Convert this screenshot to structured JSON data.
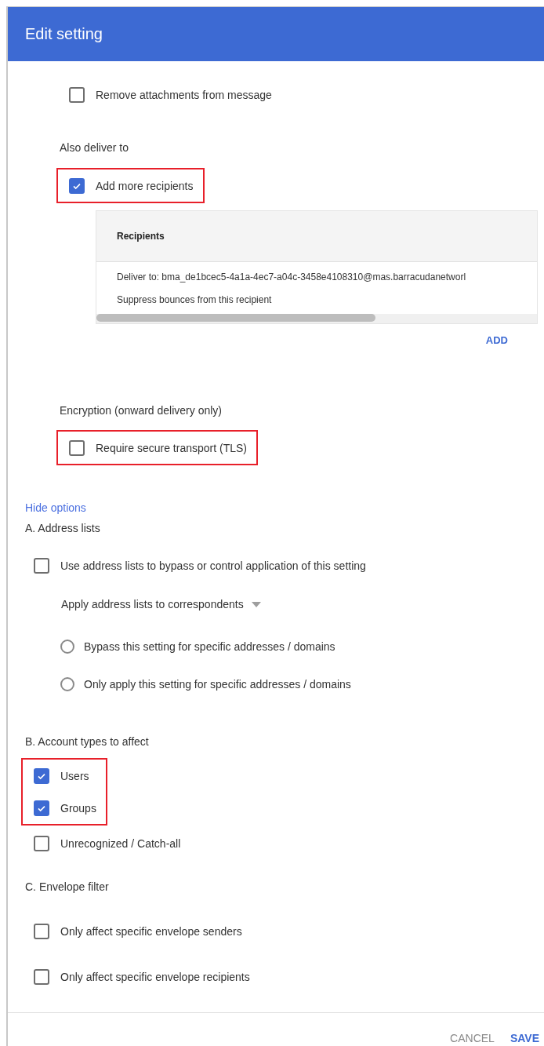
{
  "dialog": {
    "title": "Edit setting"
  },
  "attachments_option": {
    "label": "Remove attachments from message",
    "checked": false,
    "highlighted": false
  },
  "also_deliver": {
    "heading": "Also deliver to",
    "option": {
      "label": "Add more recipients",
      "checked": true,
      "highlighted": true
    },
    "recipients_table": {
      "column": "Recipients",
      "rows": [
        {
          "lines": [
            "Deliver to: bma_de1bcec5-4a1a-4ec7-a04c-3458e4108310@mas.barracudanetworl",
            "Suppress bounces from this recipient"
          ]
        }
      ]
    },
    "add_button": "ADD"
  },
  "encryption": {
    "heading": "Encryption (onward delivery only)",
    "option": {
      "label": "Require secure transport (TLS)",
      "checked": false,
      "highlighted": true
    }
  },
  "hide_options_link": "Hide options",
  "address_lists": {
    "heading": "A. Address lists",
    "option": {
      "label": "Use address lists to bypass or control application of this setting",
      "checked": false,
      "highlighted": false
    },
    "dropdown": {
      "label": "Apply address lists to correspondents"
    },
    "radios": [
      {
        "label": "Bypass this setting for specific addresses / domains",
        "selected": false
      },
      {
        "label": "Only apply this setting for specific addresses / domains",
        "selected": false
      }
    ]
  },
  "account_types": {
    "heading": "B. Account types to affect",
    "options": [
      {
        "label": "Users",
        "checked": true,
        "highlighted": true
      },
      {
        "label": "Groups",
        "checked": true,
        "highlighted": true
      },
      {
        "label": "Unrecognized / Catch-all",
        "checked": false,
        "highlighted": false
      }
    ]
  },
  "envelope_filter": {
    "heading": "C. Envelope filter",
    "options": [
      {
        "label": "Only affect specific envelope senders",
        "checked": false,
        "highlighted": false
      },
      {
        "label": "Only affect specific envelope recipients",
        "checked": false,
        "highlighted": false
      }
    ]
  },
  "footer": {
    "buttons": [
      {
        "label": "CANCEL",
        "kind": "secondary"
      },
      {
        "label": "SAVE",
        "kind": "primary"
      }
    ]
  }
}
